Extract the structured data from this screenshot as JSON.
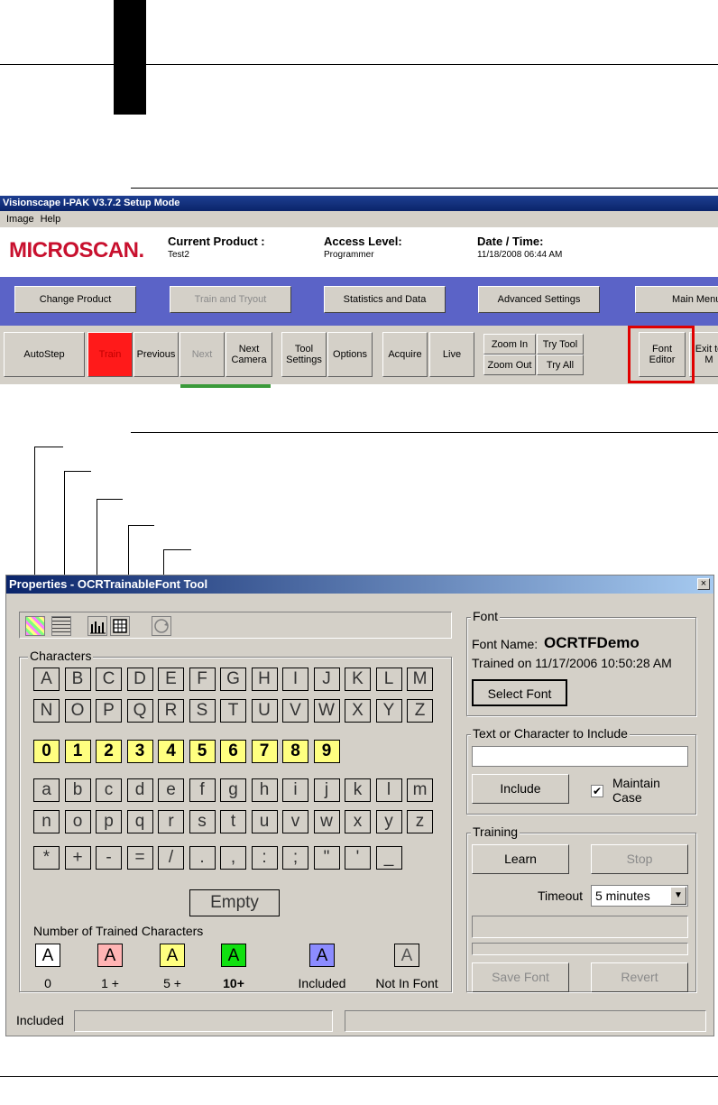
{
  "top_banner": {},
  "screenshot1": {
    "title": "Visionscape I-PAK V3.7.2 Setup Mode",
    "menu": [
      "Image",
      "Help"
    ],
    "logo": "MICROSCAN.",
    "current_product_label": "Current Product :",
    "current_product_value": "Test2",
    "access_level_label": "Access Level:",
    "access_level_value": "Programmer",
    "date_time_label": "Date / Time:",
    "date_time_value": "11/18/2008 06:44 AM",
    "nav": [
      "Change Product",
      "Train and Tryout",
      "Statistics and Data",
      "Advanced Settings",
      "Main Menu"
    ],
    "toolbar": {
      "autostep": "AutoStep",
      "train": "Train",
      "previous": "Previous",
      "next": "Next",
      "next_camera": "Next Camera",
      "tool_settings": "Tool Settings",
      "options": "Options",
      "acquire": "Acquire",
      "live": "Live",
      "zoom_in": "Zoom In",
      "zoom_out": "Zoom Out",
      "try_tool": "Try Tool",
      "try_all": "Try All",
      "font_editor": "Font Editor",
      "exit": "Exit to M"
    }
  },
  "dialog": {
    "title": "Properties - OCRTrainableFont Tool",
    "close": "×",
    "characters_label": "Characters",
    "rows": [
      [
        "A",
        "B",
        "C",
        "D",
        "E",
        "F",
        "G",
        "H",
        "I",
        "J",
        "K",
        "L",
        "M"
      ],
      [
        "N",
        "O",
        "P",
        "Q",
        "R",
        "S",
        "T",
        "U",
        "V",
        "W",
        "X",
        "Y",
        "Z"
      ],
      [
        "0",
        "1",
        "2",
        "3",
        "4",
        "5",
        "6",
        "7",
        "8",
        "9"
      ],
      [
        "a",
        "b",
        "c",
        "d",
        "e",
        "f",
        "g",
        "h",
        "i",
        "j",
        "k",
        "l",
        "m"
      ],
      [
        "n",
        "o",
        "p",
        "q",
        "r",
        "s",
        "t",
        "u",
        "v",
        "w",
        "x",
        "y",
        "z"
      ],
      [
        "*",
        "+",
        "-",
        "=",
        "/",
        ".",
        ",",
        ":",
        ";",
        "\"",
        "'",
        "_"
      ]
    ],
    "empty": "Empty",
    "trained_label": "Number of Trained Characters",
    "legend": [
      {
        "glyph": "A",
        "label": "0",
        "color": "#ffffff"
      },
      {
        "glyph": "A",
        "label": "1 +",
        "color": "#ffb4b4"
      },
      {
        "glyph": "A",
        "label": "5 +",
        "color": "#ffff80"
      },
      {
        "glyph": "A",
        "label": "10+",
        "color": "#10e010"
      },
      {
        "glyph": "A",
        "label": "Included",
        "color": "#8c8cff"
      },
      {
        "glyph": "A",
        "label": "Not In Font",
        "color": "#d4d0c8"
      }
    ],
    "font_group": "Font",
    "font_name_label": "Font Name:",
    "font_name_value": "OCRTFDemo",
    "trained_on": "Trained on 11/17/2006 10:50:28 AM",
    "select_font": "Select Font",
    "text_group": "Text or Character to Include",
    "include_input": "",
    "include": "Include",
    "maintain_case": "Maintain Case",
    "training_group": "Training",
    "learn": "Learn",
    "stop": "Stop",
    "timeout_label": "Timeout",
    "timeout_value": "5 minutes",
    "save_font": "Save Font",
    "revert": "Revert",
    "status": "Included",
    "status_value": ""
  }
}
